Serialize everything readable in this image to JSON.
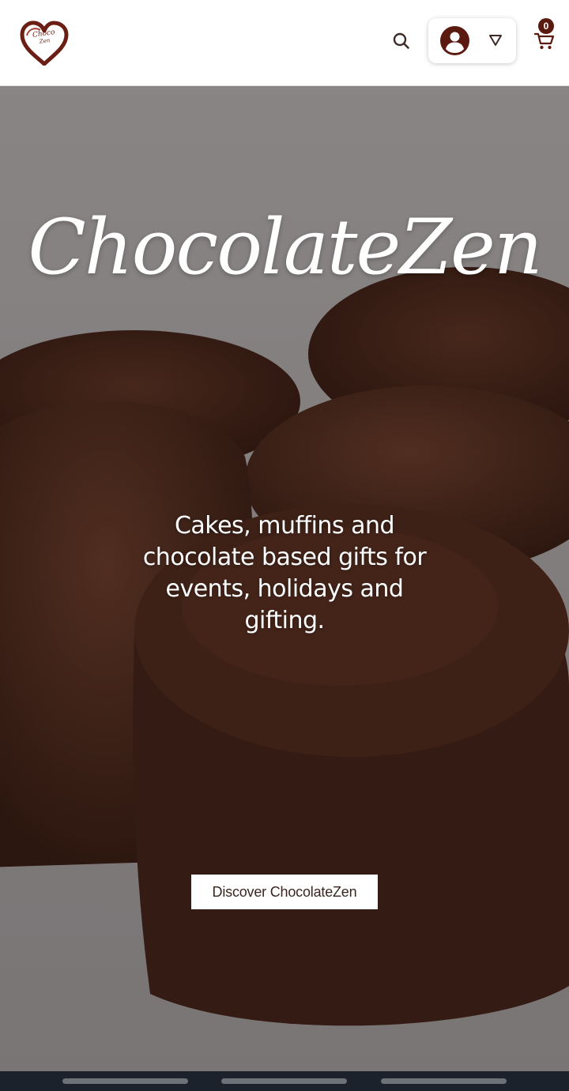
{
  "header": {
    "logo": {
      "text_line1": "Choco",
      "text_line2": "Zen",
      "icon": "heart-logo-icon"
    },
    "search": {
      "icon": "search-icon"
    },
    "account": {
      "avatar_icon": "user-avatar-icon",
      "caret_icon": "caret-down-icon"
    },
    "cart": {
      "icon": "cart-icon",
      "count": "0"
    }
  },
  "hero": {
    "brand_script": "ChocolateZen",
    "tagline": "Cakes, muffins and chocolate based gifts for events, holidays and gifting.",
    "cta_label": "Discover ChocolateZen",
    "background": "chocolate-muffins-photo"
  },
  "colors": {
    "brand": "#6b1e14",
    "badge": "#5a1a10",
    "navbar": "#1b222c"
  }
}
